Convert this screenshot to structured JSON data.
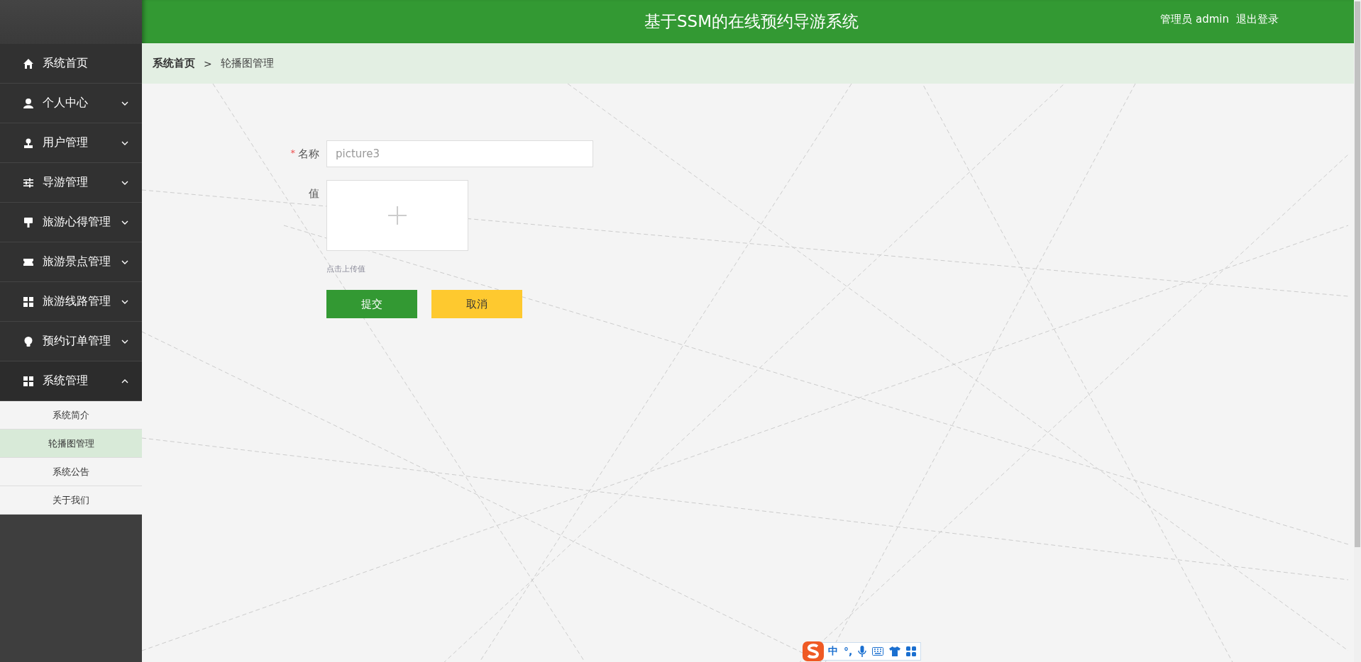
{
  "header": {
    "title": "基于SSM的在线预约导游系统",
    "user_label": "管理员 admin",
    "logout": "退出登录"
  },
  "sidebar": {
    "items": [
      {
        "label": "系统首页",
        "kind": "link"
      },
      {
        "label": "个人中心",
        "kind": "group",
        "expanded": false
      },
      {
        "label": "用户管理",
        "kind": "group",
        "expanded": false
      },
      {
        "label": "导游管理",
        "kind": "group",
        "expanded": false
      },
      {
        "label": "旅游心得管理",
        "kind": "group",
        "expanded": false
      },
      {
        "label": "旅游景点管理",
        "kind": "group",
        "expanded": false
      },
      {
        "label": "旅游线路管理",
        "kind": "group",
        "expanded": false
      },
      {
        "label": "预约订单管理",
        "kind": "group",
        "expanded": false
      },
      {
        "label": "系统管理",
        "kind": "group",
        "expanded": true,
        "children": [
          {
            "label": "系统简介",
            "selected": false
          },
          {
            "label": "轮播图管理",
            "selected": true
          },
          {
            "label": "系统公告",
            "selected": false
          },
          {
            "label": "关于我们",
            "selected": false
          }
        ]
      }
    ]
  },
  "breadcrumb": [
    "系统首页",
    "轮播图管理"
  ],
  "breadcrumb_separator": ">",
  "form": {
    "fields": [
      {
        "kind": "text",
        "label": "名称",
        "required_mark": "*",
        "value": "picture3"
      },
      {
        "kind": "upload",
        "label": "值",
        "hint": "点击上传值"
      }
    ],
    "buttons": [
      {
        "label": "提交",
        "kind": "primary"
      },
      {
        "label": "取消",
        "kind": "secondary"
      }
    ]
  },
  "ime_toolbar": {
    "mode": "中",
    "punctuation": "°,"
  }
}
